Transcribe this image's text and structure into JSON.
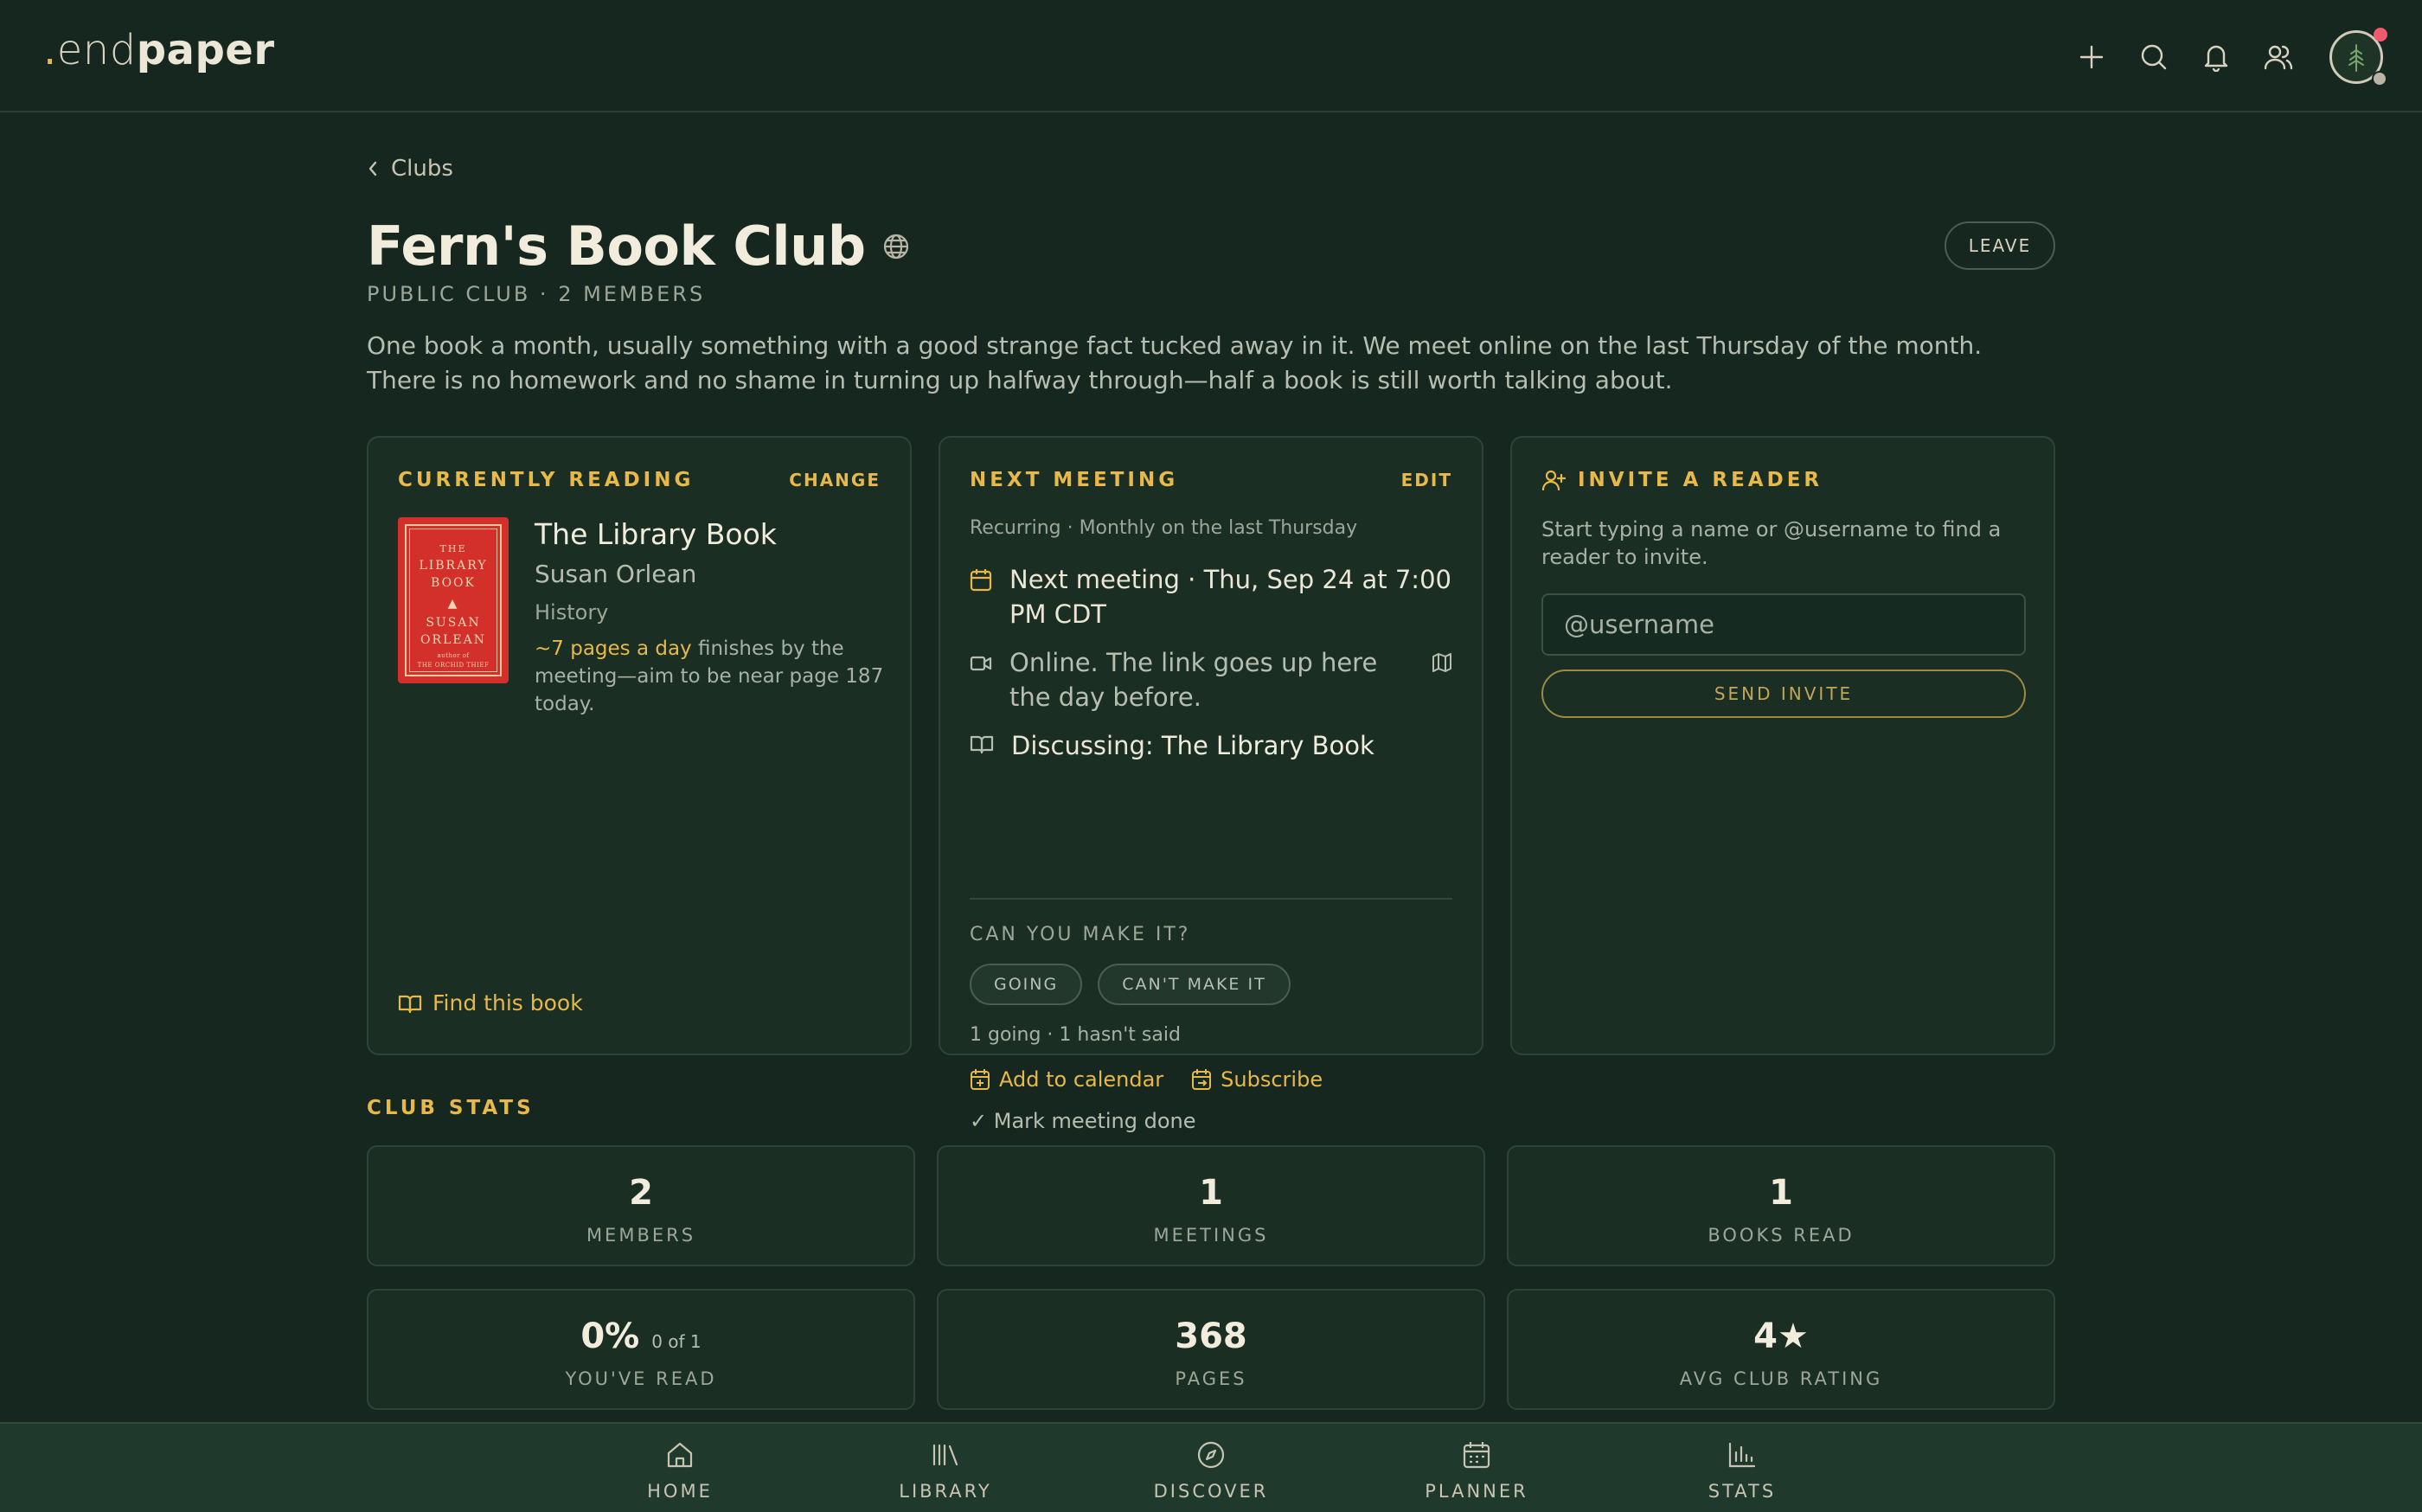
{
  "brand": {
    "dot": ".",
    "light": "end",
    "bold": "paper"
  },
  "header_icons": [
    "plus-icon",
    "search-icon",
    "bell-icon",
    "users-icon",
    "avatar"
  ],
  "breadcrumb": {
    "back_label": "Clubs"
  },
  "club": {
    "name": "Fern's Book Club",
    "meta": "PUBLIC CLUB · 2 MEMBERS",
    "description": "One book a month, usually something with a good strange fact tucked away in it. We meet online on the last Thursday of the month. There is no homework and no shame in turning up halfway through—half a book is still worth talking about.",
    "leave_label": "LEAVE"
  },
  "reading": {
    "title": "CURRENTLY READING",
    "action": "CHANGE",
    "book_title": "The Library Book",
    "author": "Susan Orlean",
    "genre": "History",
    "pace_highlight": "~7 pages a day",
    "pace_rest": " finishes by the meeting—aim to be near page 187 today.",
    "find_label": "Find this book",
    "cover": {
      "line1": "THE",
      "line2": "LIBRARY",
      "line3": "BOOK",
      "line4": "SUSAN",
      "line5": "ORLEAN",
      "line6": "author of",
      "line7": "THE ORCHID THIEF"
    }
  },
  "meeting": {
    "title": "NEXT MEETING",
    "action": "EDIT",
    "recurring": "Recurring · Monthly on the last Thursday",
    "next": "Next meeting · Thu, Sep 24 at 7:00 PM CDT",
    "location": "Online. The link goes up here the day before.",
    "discussing_label": "Discussing: ",
    "discussing_book": "The Library Book",
    "rsvp_label": "CAN YOU MAKE IT?",
    "going": "GOING",
    "cant": "CAN'T MAKE IT",
    "rsvp_count": "1 going · 1 hasn't said",
    "add_calendar": "Add to calendar",
    "subscribe": "Subscribe",
    "mark_done": "✓ Mark meeting done"
  },
  "invite": {
    "title": "INVITE A READER",
    "hint": "Start typing a name or @username to find a reader to invite.",
    "placeholder": "@username",
    "send_label": "SEND INVITE"
  },
  "stats": {
    "title": "CLUB STATS",
    "members": {
      "value": "2",
      "label": "MEMBERS"
    },
    "meetings": {
      "value": "1",
      "label": "MEETINGS"
    },
    "books": {
      "value": "1",
      "label": "BOOKS READ"
    },
    "read": {
      "value": "0%",
      "sub": "0 of 1",
      "label": "YOU'VE READ"
    },
    "pages": {
      "value": "368",
      "label": "PAGES"
    },
    "rating": {
      "value": "4★",
      "label": "AVG CLUB RATING"
    }
  },
  "nav": {
    "home": "HOME",
    "library": "LIBRARY",
    "discover": "DISCOVER",
    "planner": "PLANNER",
    "stats": "STATS"
  },
  "colors": {
    "background": "#15271e",
    "card": "#1a2e23",
    "accent": "#e8b84a",
    "nav": "#1f3a2c"
  }
}
